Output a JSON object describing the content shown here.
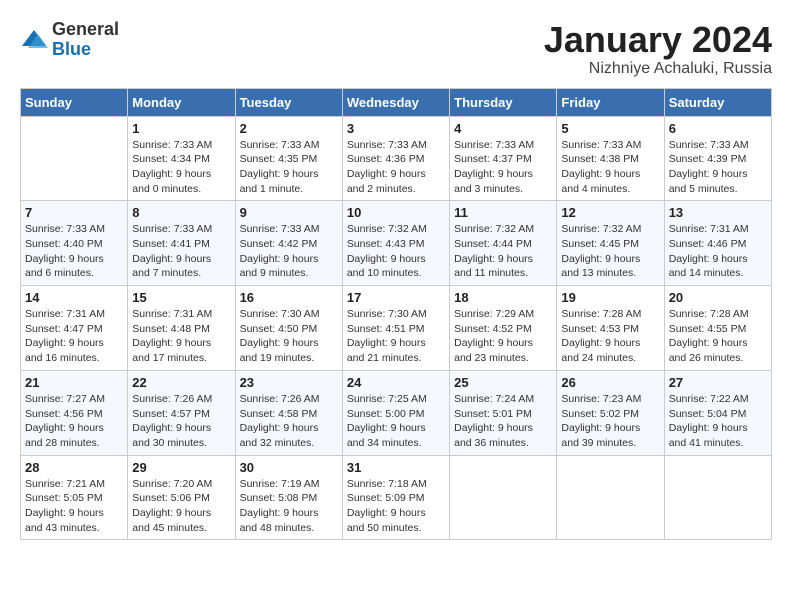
{
  "logo": {
    "general": "General",
    "blue": "Blue"
  },
  "header": {
    "month": "January 2024",
    "location": "Nizhniye Achaluki, Russia"
  },
  "days_of_week": [
    "Sunday",
    "Monday",
    "Tuesday",
    "Wednesday",
    "Thursday",
    "Friday",
    "Saturday"
  ],
  "weeks": [
    [
      {
        "day": "",
        "info": ""
      },
      {
        "day": "1",
        "info": "Sunrise: 7:33 AM\nSunset: 4:34 PM\nDaylight: 9 hours\nand 0 minutes."
      },
      {
        "day": "2",
        "info": "Sunrise: 7:33 AM\nSunset: 4:35 PM\nDaylight: 9 hours\nand 1 minute."
      },
      {
        "day": "3",
        "info": "Sunrise: 7:33 AM\nSunset: 4:36 PM\nDaylight: 9 hours\nand 2 minutes."
      },
      {
        "day": "4",
        "info": "Sunrise: 7:33 AM\nSunset: 4:37 PM\nDaylight: 9 hours\nand 3 minutes."
      },
      {
        "day": "5",
        "info": "Sunrise: 7:33 AM\nSunset: 4:38 PM\nDaylight: 9 hours\nand 4 minutes."
      },
      {
        "day": "6",
        "info": "Sunrise: 7:33 AM\nSunset: 4:39 PM\nDaylight: 9 hours\nand 5 minutes."
      }
    ],
    [
      {
        "day": "7",
        "info": "Sunrise: 7:33 AM\nSunset: 4:40 PM\nDaylight: 9 hours\nand 6 minutes."
      },
      {
        "day": "8",
        "info": "Sunrise: 7:33 AM\nSunset: 4:41 PM\nDaylight: 9 hours\nand 7 minutes."
      },
      {
        "day": "9",
        "info": "Sunrise: 7:33 AM\nSunset: 4:42 PM\nDaylight: 9 hours\nand 9 minutes."
      },
      {
        "day": "10",
        "info": "Sunrise: 7:32 AM\nSunset: 4:43 PM\nDaylight: 9 hours\nand 10 minutes."
      },
      {
        "day": "11",
        "info": "Sunrise: 7:32 AM\nSunset: 4:44 PM\nDaylight: 9 hours\nand 11 minutes."
      },
      {
        "day": "12",
        "info": "Sunrise: 7:32 AM\nSunset: 4:45 PM\nDaylight: 9 hours\nand 13 minutes."
      },
      {
        "day": "13",
        "info": "Sunrise: 7:31 AM\nSunset: 4:46 PM\nDaylight: 9 hours\nand 14 minutes."
      }
    ],
    [
      {
        "day": "14",
        "info": "Sunrise: 7:31 AM\nSunset: 4:47 PM\nDaylight: 9 hours\nand 16 minutes."
      },
      {
        "day": "15",
        "info": "Sunrise: 7:31 AM\nSunset: 4:48 PM\nDaylight: 9 hours\nand 17 minutes."
      },
      {
        "day": "16",
        "info": "Sunrise: 7:30 AM\nSunset: 4:50 PM\nDaylight: 9 hours\nand 19 minutes."
      },
      {
        "day": "17",
        "info": "Sunrise: 7:30 AM\nSunset: 4:51 PM\nDaylight: 9 hours\nand 21 minutes."
      },
      {
        "day": "18",
        "info": "Sunrise: 7:29 AM\nSunset: 4:52 PM\nDaylight: 9 hours\nand 23 minutes."
      },
      {
        "day": "19",
        "info": "Sunrise: 7:28 AM\nSunset: 4:53 PM\nDaylight: 9 hours\nand 24 minutes."
      },
      {
        "day": "20",
        "info": "Sunrise: 7:28 AM\nSunset: 4:55 PM\nDaylight: 9 hours\nand 26 minutes."
      }
    ],
    [
      {
        "day": "21",
        "info": "Sunrise: 7:27 AM\nSunset: 4:56 PM\nDaylight: 9 hours\nand 28 minutes."
      },
      {
        "day": "22",
        "info": "Sunrise: 7:26 AM\nSunset: 4:57 PM\nDaylight: 9 hours\nand 30 minutes."
      },
      {
        "day": "23",
        "info": "Sunrise: 7:26 AM\nSunset: 4:58 PM\nDaylight: 9 hours\nand 32 minutes."
      },
      {
        "day": "24",
        "info": "Sunrise: 7:25 AM\nSunset: 5:00 PM\nDaylight: 9 hours\nand 34 minutes."
      },
      {
        "day": "25",
        "info": "Sunrise: 7:24 AM\nSunset: 5:01 PM\nDaylight: 9 hours\nand 36 minutes."
      },
      {
        "day": "26",
        "info": "Sunrise: 7:23 AM\nSunset: 5:02 PM\nDaylight: 9 hours\nand 39 minutes."
      },
      {
        "day": "27",
        "info": "Sunrise: 7:22 AM\nSunset: 5:04 PM\nDaylight: 9 hours\nand 41 minutes."
      }
    ],
    [
      {
        "day": "28",
        "info": "Sunrise: 7:21 AM\nSunset: 5:05 PM\nDaylight: 9 hours\nand 43 minutes."
      },
      {
        "day": "29",
        "info": "Sunrise: 7:20 AM\nSunset: 5:06 PM\nDaylight: 9 hours\nand 45 minutes."
      },
      {
        "day": "30",
        "info": "Sunrise: 7:19 AM\nSunset: 5:08 PM\nDaylight: 9 hours\nand 48 minutes."
      },
      {
        "day": "31",
        "info": "Sunrise: 7:18 AM\nSunset: 5:09 PM\nDaylight: 9 hours\nand 50 minutes."
      },
      {
        "day": "",
        "info": ""
      },
      {
        "day": "",
        "info": ""
      },
      {
        "day": "",
        "info": ""
      }
    ]
  ]
}
